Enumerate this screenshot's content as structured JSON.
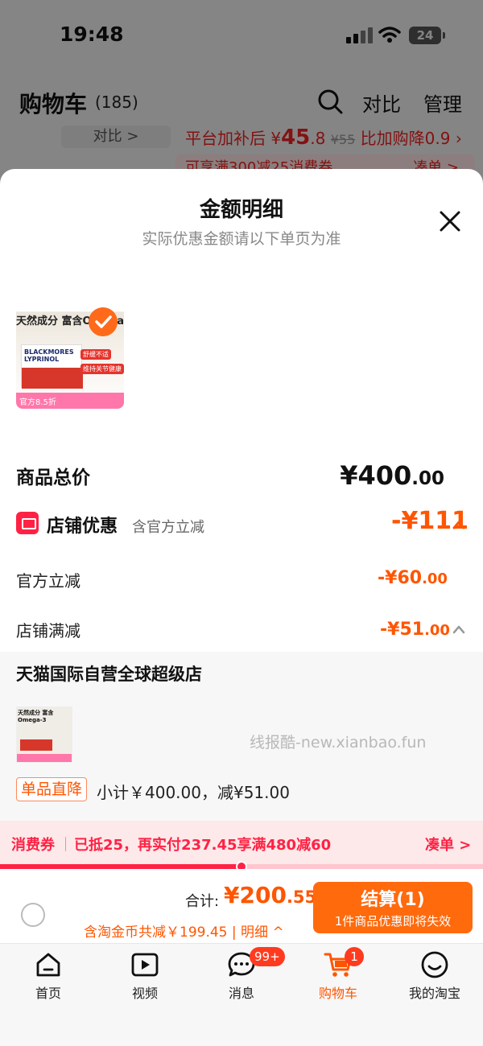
{
  "status_bar": {
    "time": "19:48",
    "battery": "24"
  },
  "cart_header": {
    "title": "购物车",
    "count": "(185)",
    "compare": "对比",
    "manage": "管理"
  },
  "promo": {
    "compare_pill": "对比 >",
    "prefix": "平台加补后 ¥",
    "price_int": "45",
    "price_dec": ".8",
    "orig": "¥55",
    "suffix": "比加购降0.9",
    "line2": "可享满300减25消费券",
    "line2_action": "凑单 >"
  },
  "sheet": {
    "title": "金额明细",
    "subtitle": "实际优惠金额请以下单页为准",
    "product_thumb": {
      "headline": "天然成分 富含Omega-3",
      "brand": "BLACKMORES LYPRINOL",
      "tag1": "舒缓不适",
      "tag2": "维持关节健康",
      "footer": "官方8.5折"
    },
    "total": {
      "label": "商品总价",
      "int": "¥400",
      "dec": ".00"
    },
    "shop_discount": {
      "label": "店铺优惠",
      "note": "含官方立减",
      "value": "-¥111"
    },
    "items": [
      {
        "label": "官方立减",
        "int": "-¥60",
        "dec": ".00"
      },
      {
        "label": "店铺满减",
        "int": "-¥51",
        "dec": ".00"
      }
    ],
    "store": {
      "name": "天猫国际自营全球超级店",
      "watermark": "线报酷-new.xianbao.fun",
      "badge": "单品直降",
      "subtotal": "小计￥400.00，减¥51.00"
    }
  },
  "coupon": {
    "tag": "消费券",
    "text": "已抵25，再实付237.45享满480减60",
    "action": "凑单 >",
    "progress": 0.5
  },
  "checkout": {
    "total_label": "合计:",
    "total_int": "¥200",
    "total_dec": ".55",
    "coins": "含淘金币共减￥199.45 | 明细",
    "button": "结算(1)",
    "button_sub": "1件商品优惠即将失效"
  },
  "tabs": [
    {
      "label": "首页",
      "icon": "home-icon"
    },
    {
      "label": "视频",
      "icon": "video-icon"
    },
    {
      "label": "消息",
      "icon": "message-icon",
      "badge": "99+"
    },
    {
      "label": "购物车",
      "icon": "cart-icon",
      "badge": "1",
      "active": true
    },
    {
      "label": "我的淘宝",
      "icon": "profile-icon"
    }
  ],
  "colors": {
    "accent": "#ff5500",
    "coupon": "#ff2244",
    "checkout_button": "#ff6a0d"
  }
}
